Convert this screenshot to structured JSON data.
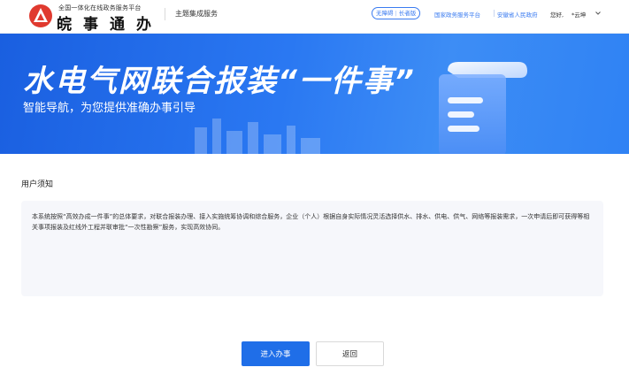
{
  "header": {
    "logo_icon": "anhui-logo-icon",
    "platform_name": "全国一体化在线政务服务平台",
    "brand_name": "皖事通办",
    "theme_label": "主题集成服务",
    "accessibility": {
      "barrier_free": "无障碍",
      "divider": "|",
      "elder_mode": "长者版"
    },
    "link_national": "国家政务服务平台",
    "link_province": "安徽省人民政府",
    "greeting": "您好,",
    "username": "*云坤",
    "dropdown_icon": "chevron-down-icon"
  },
  "banner": {
    "title": "水电气网联合报装“一件事”",
    "subtitle": "智能导航，为您提供准确办事引导",
    "illustration_icon": "document-scroll-icon"
  },
  "notice": {
    "title": "用户须知",
    "text": "本系统按照“高效办成一件事”的总体要求，对联合报装办理、接入实施统筹协调和综合服务，企业（个人）根据自身实际情况灵活选择供水、排水、供电、供气、网络等报装需求，一次申请后即可获得等相关事项报装及红线外工程并联审批“一次性勘察”服务，实现高效协同。"
  },
  "actions": {
    "enter_label": "进入办事",
    "back_label": "返回"
  },
  "colors": {
    "primary": "#1f6ee8",
    "banner_start": "#1a5fe0",
    "banner_end": "#3d8df5",
    "link": "#3a7bf0",
    "logo_red": "#e03a2f"
  }
}
